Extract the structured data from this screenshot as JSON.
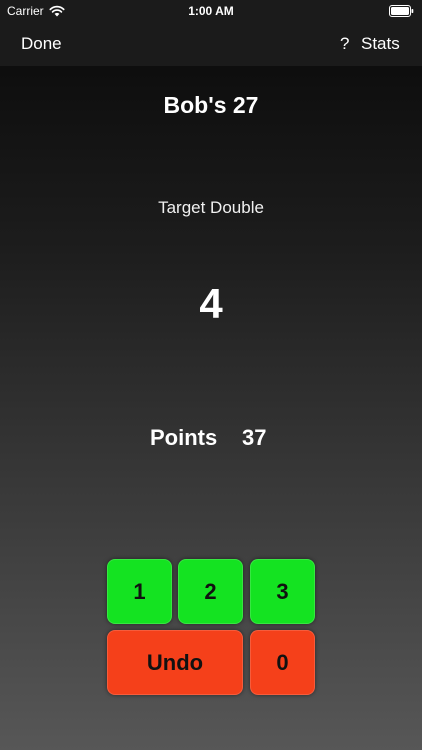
{
  "status_bar": {
    "carrier": "Carrier",
    "time": "1:00 AM",
    "icons": [
      "wifi-icon",
      "battery-icon"
    ]
  },
  "nav": {
    "done_label": "Done",
    "help_label": "?",
    "stats_label": "Stats"
  },
  "game": {
    "title": "Bob's 27",
    "target_label": "Target Double",
    "target_value": "4",
    "points_label": "Points",
    "points_value": "37"
  },
  "keypad": {
    "key_1": "1",
    "key_2": "2",
    "key_3": "3",
    "undo": "Undo",
    "key_0": "0"
  },
  "colors": {
    "hit_key": "#14e321",
    "undo_key": "#f5401a",
    "bar_background": "#1b1b1b"
  }
}
